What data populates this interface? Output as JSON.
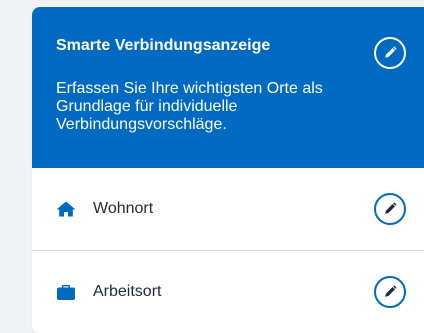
{
  "header": {
    "title": "Smarte Verbindungsanzeige",
    "description": "Erfassen Sie Ihre wichtigsten Orte als Grundlage für individuelle Verbindungsvorschläge.",
    "edit_icon": "pencil-icon"
  },
  "locations": [
    {
      "label": "Wohnort",
      "icon": "home-icon",
      "edit_icon": "pencil-icon"
    },
    {
      "label": "Arbeitsort",
      "icon": "briefcase-icon",
      "edit_icon": "pencil-icon"
    }
  ],
  "colors": {
    "accent": "#006ac3",
    "text": "#1f2b36",
    "background": "#f0f3f5",
    "divider": "#d5dbe0"
  }
}
